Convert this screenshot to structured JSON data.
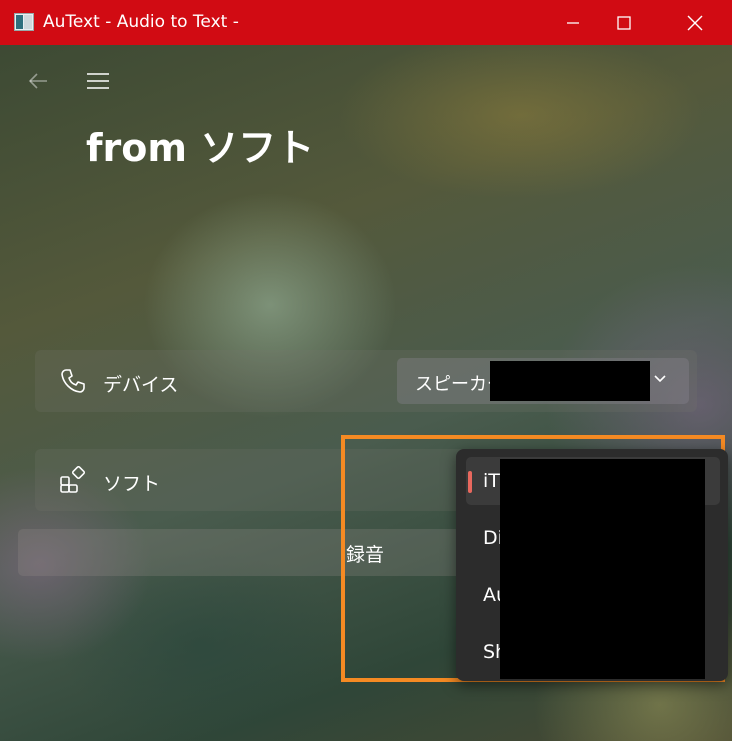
{
  "window": {
    "title": "AuText - Audio to Text -",
    "controls": [
      "minimize",
      "maximize",
      "close"
    ],
    "accent_color": "#d10b13"
  },
  "nav": {
    "back_icon": "arrow-left-icon",
    "menu_icon": "hamburger-icon"
  },
  "page": {
    "title": "from ソフト"
  },
  "device_setting": {
    "label": "デバイス",
    "icon": "phone-icon",
    "selected_value": "スピーカー"
  },
  "software_setting": {
    "label": "ソフト",
    "icon": "apps-add-icon"
  },
  "record_button": {
    "label": "録音"
  },
  "software_dropdown": {
    "options": [
      {
        "label": "iT",
        "selected": true
      },
      {
        "label": "Di",
        "selected": false
      },
      {
        "label": "Au",
        "selected": false
      },
      {
        "label": "Sh",
        "selected": false
      }
    ],
    "highlight_color": "#f58a23"
  }
}
